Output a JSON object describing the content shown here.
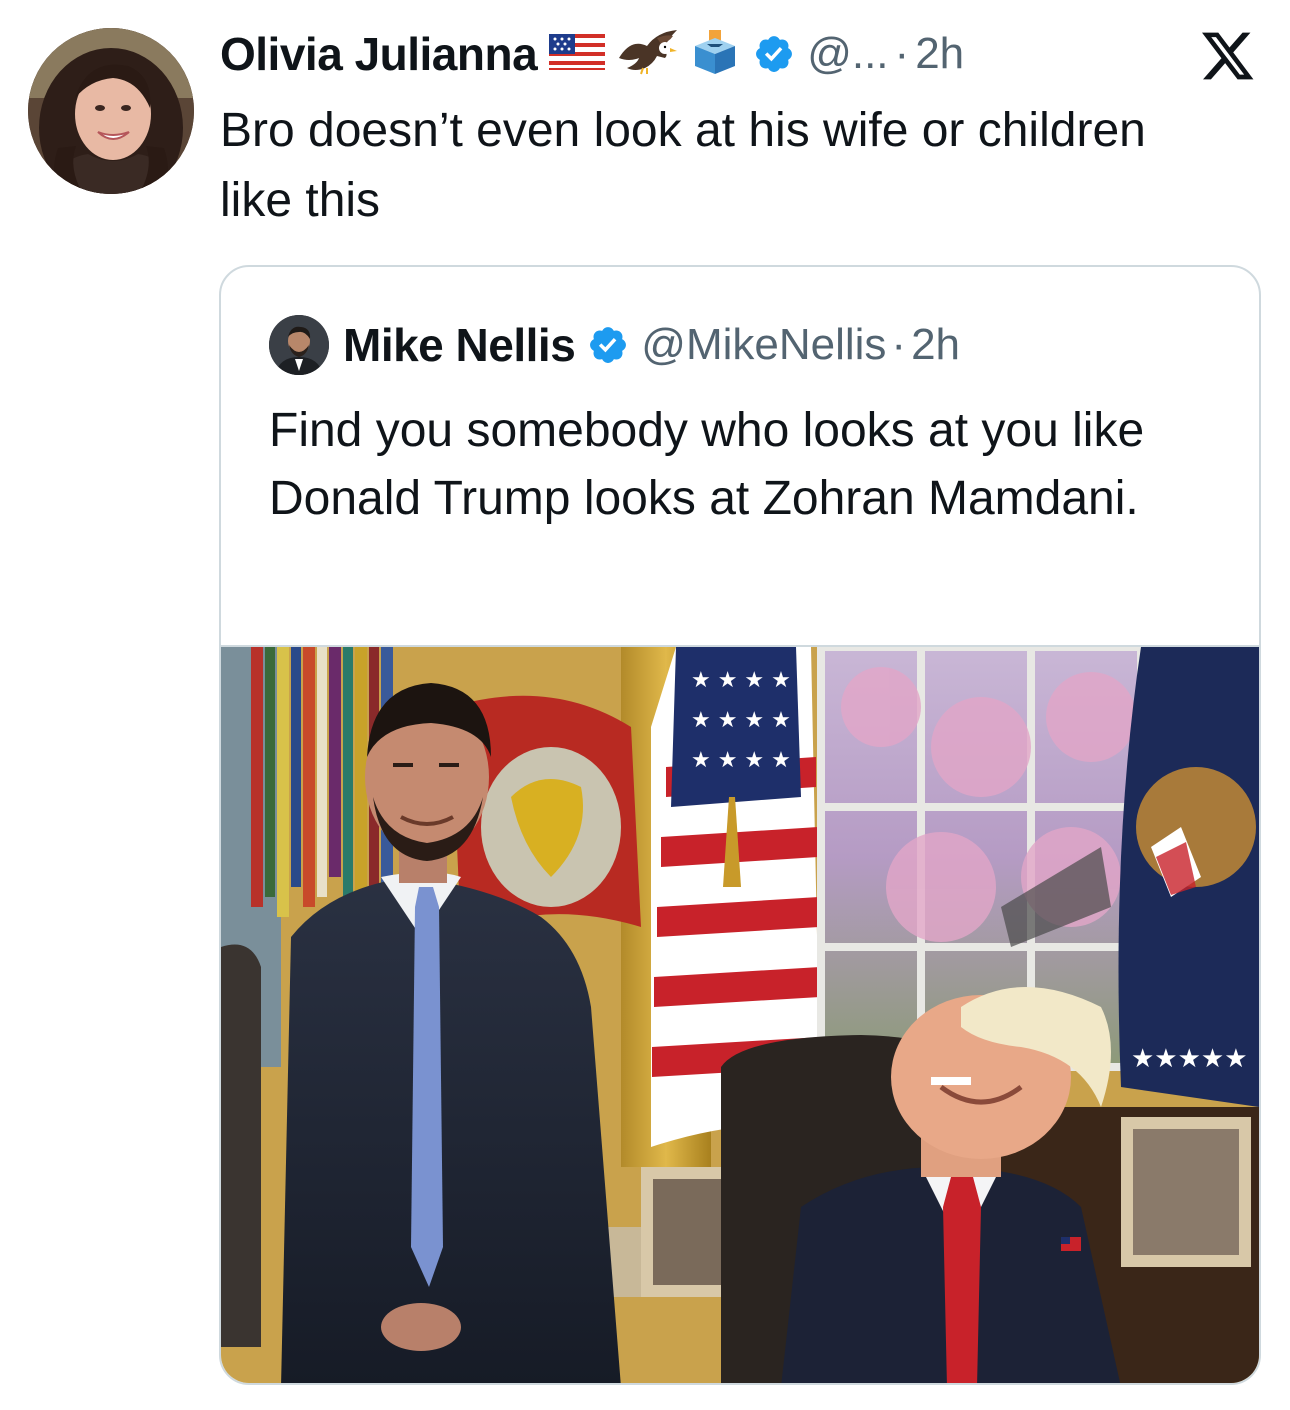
{
  "tweet": {
    "display_name": "Olivia Julianna",
    "badges": [
      "us-flag-emoji",
      "eagle-emoji",
      "ballot-box-emoji",
      "verified-badge-icon"
    ],
    "handle": "@...",
    "separator": "·",
    "time": "2h",
    "text": "Bro doesn’t even look at his wife or children like this",
    "platform_icon": "x-logo-icon"
  },
  "quote": {
    "display_name": "Mike Nellis",
    "handle": "@MikeNellis",
    "separator": "·",
    "time": "2h",
    "text": "Find you somebody who looks at you like Donald Trump looks at Zohran Mamdani.",
    "photo": "oval-office-photo"
  },
  "colors": {
    "text_primary": "#0f1419",
    "text_secondary": "#536471",
    "verified_blue": "#1d9bf0",
    "card_border": "#cfd9de"
  }
}
